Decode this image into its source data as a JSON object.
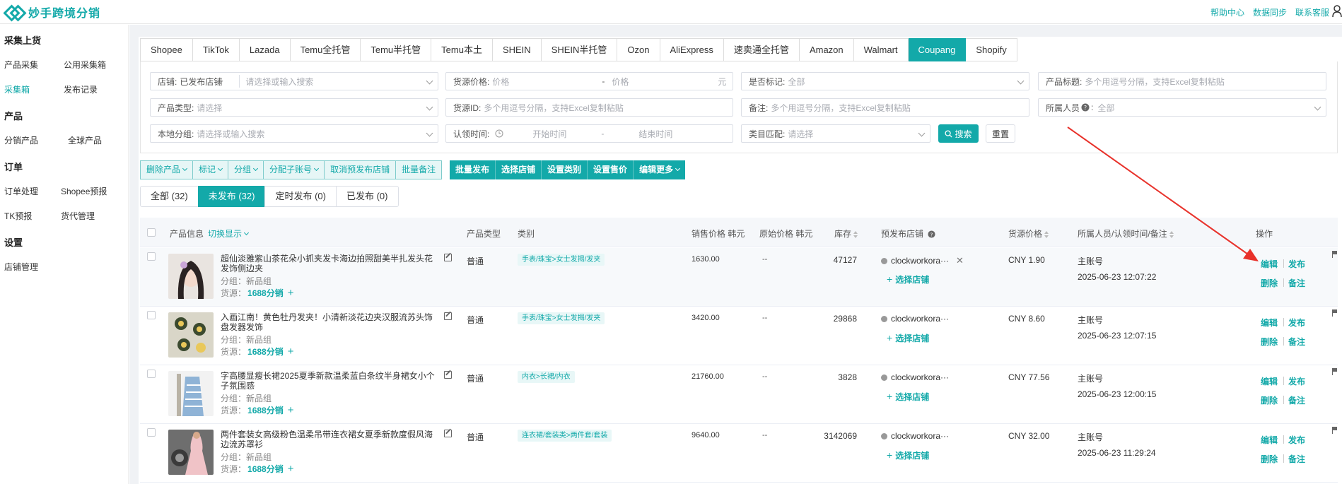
{
  "app": {
    "title": "妙手跨境分销"
  },
  "top_links": [
    "帮助中心",
    "数据同步",
    "联系客服"
  ],
  "sidebar": {
    "groups": [
      {
        "title": "采集上货",
        "items": [
          "产品采集",
          "公用采集箱",
          "采集箱",
          "发布记录"
        ]
      },
      {
        "title": "产品",
        "items": [
          "分销产品",
          "全球产品"
        ]
      },
      {
        "title": "订单",
        "items": [
          "订单处理",
          "Shopee预报",
          "TK预报",
          "货代管理"
        ]
      },
      {
        "title": "设置",
        "items": [
          "店铺管理"
        ]
      }
    ],
    "active": "采集箱"
  },
  "platform_tabs": [
    "Shopee",
    "TikTok",
    "Lazada",
    "Temu全托管",
    "Temu半托管",
    "Temu本土",
    "SHEIN",
    "SHEIN半托管",
    "Ozon",
    "AliExpress",
    "速卖通全托管",
    "Amazon",
    "Walmart",
    "Coupang",
    "Shopify"
  ],
  "active_platform": "Coupang",
  "filters": {
    "store": {
      "label": "店铺:",
      "value": "已发布店铺",
      "placeholder": "请选择或输入搜索"
    },
    "price": {
      "label": "货源价格:",
      "min_ph": "价格",
      "sep": "-",
      "max_ph": "价格",
      "unit": "元"
    },
    "marked": {
      "label": "是否标记:",
      "value": "全部"
    },
    "title": {
      "label": "产品标题:",
      "placeholder": "多个用逗号分隔，支持Excel复制粘贴"
    },
    "type": {
      "label": "产品类型:",
      "placeholder": "请选择"
    },
    "source_id": {
      "label": "货源ID:",
      "placeholder": "多个用逗号分隔，支持Excel复制粘贴"
    },
    "remark": {
      "label": "备注:",
      "placeholder": "多个用逗号分隔，支持Excel复制粘贴"
    },
    "owner": {
      "label": "所属人员",
      "value": "全部"
    },
    "group": {
      "label": "本地分组:",
      "placeholder": "请选择或输入搜索"
    },
    "claim_time": {
      "label": "认领时间:",
      "start_ph": "开始时间",
      "sep": "-",
      "end_ph": "结束时间"
    },
    "category": {
      "label": "类目匹配:",
      "placeholder": "请选择"
    },
    "search_label": "搜索",
    "reset_label": "重置"
  },
  "actions_light": [
    "删除产品",
    "标记",
    "分组",
    "分配子账号",
    "取消预发布店铺",
    "批量备注"
  ],
  "actions_dark": [
    "批量发布",
    "选择店铺",
    "设置类别",
    "设置售价",
    "编辑更多"
  ],
  "status_tabs": [
    "全部 (32)",
    "未发布 (32)",
    "定时发布 (0)",
    "已发布 (0)"
  ],
  "active_status": "未发布 (32)",
  "table": {
    "headers": {
      "info": "产品信息",
      "toggle": "切换显示",
      "type": "产品类型",
      "category": "类别",
      "sale": "销售价格 韩元",
      "orig": "原始价格 韩元",
      "stock": "库存",
      "store": "预发布店铺",
      "price": "货源价格",
      "owner": "所属人员/认领时间/备注",
      "ops": "操作"
    },
    "group_prefix": "分组：",
    "source_prefix": "货源：",
    "select_store": "选择店铺",
    "op_labels": {
      "edit": "编辑",
      "publish": "发布",
      "delete": "删除",
      "remark": "备注"
    },
    "rows": [
      {
        "title": "超仙淡雅紫山茶花朵小抓夹发卡海边拍照甜美半扎发头花发饰侧边夹",
        "group": "新品组",
        "source": "1688分销",
        "type": "普通",
        "category": "手表/珠宝>女士发揭/发夹",
        "sale": "1630.00",
        "orig": "--",
        "stock": "47127",
        "store": "clockworkora···",
        "price": "CNY 1.90",
        "owner": "主账号",
        "time": "2025-06-23 12:07:22"
      },
      {
        "title": "入画江南！黄色牡丹发夹！小清新淡花边夹汉服流苏头饰盘发器发饰",
        "group": "新品组",
        "source": "1688分销",
        "type": "普通",
        "category": "手表/珠宝>女士发揭/发夹",
        "sale": "3420.00",
        "orig": "--",
        "stock": "29868",
        "store": "clockworkora···",
        "price": "CNY 8.60",
        "owner": "主账号",
        "time": "2025-06-23 12:07:15"
      },
      {
        "title": "字高腰显瘦长裙2025夏季新款温柔蓝白条纹半身裙女小个子氛围感",
        "group": "新品组",
        "source": "1688分销",
        "type": "普通",
        "category": "内衣>长裙/内衣",
        "sale": "21760.00",
        "orig": "--",
        "stock": "3828",
        "store": "clockworkora···",
        "price": "CNY 77.56",
        "owner": "主账号",
        "time": "2025-06-23 12:00:15"
      },
      {
        "title": "两件套装女高级粉色温柔吊带连衣裙女夏季新款度假风海边流苏罩衫",
        "group": "新品组",
        "source": "1688分销",
        "type": "普通",
        "category": "连衣裙/套装类>两件套/套装",
        "sale": "9640.00",
        "orig": "--",
        "stock": "3142069",
        "store": "clockworkora···",
        "price": "CNY 32.00",
        "owner": "主账号",
        "time": "2025-06-23 11:29:24"
      }
    ]
  },
  "colors": {
    "accent": "#13a9a9",
    "arrow": "#e8312a"
  }
}
